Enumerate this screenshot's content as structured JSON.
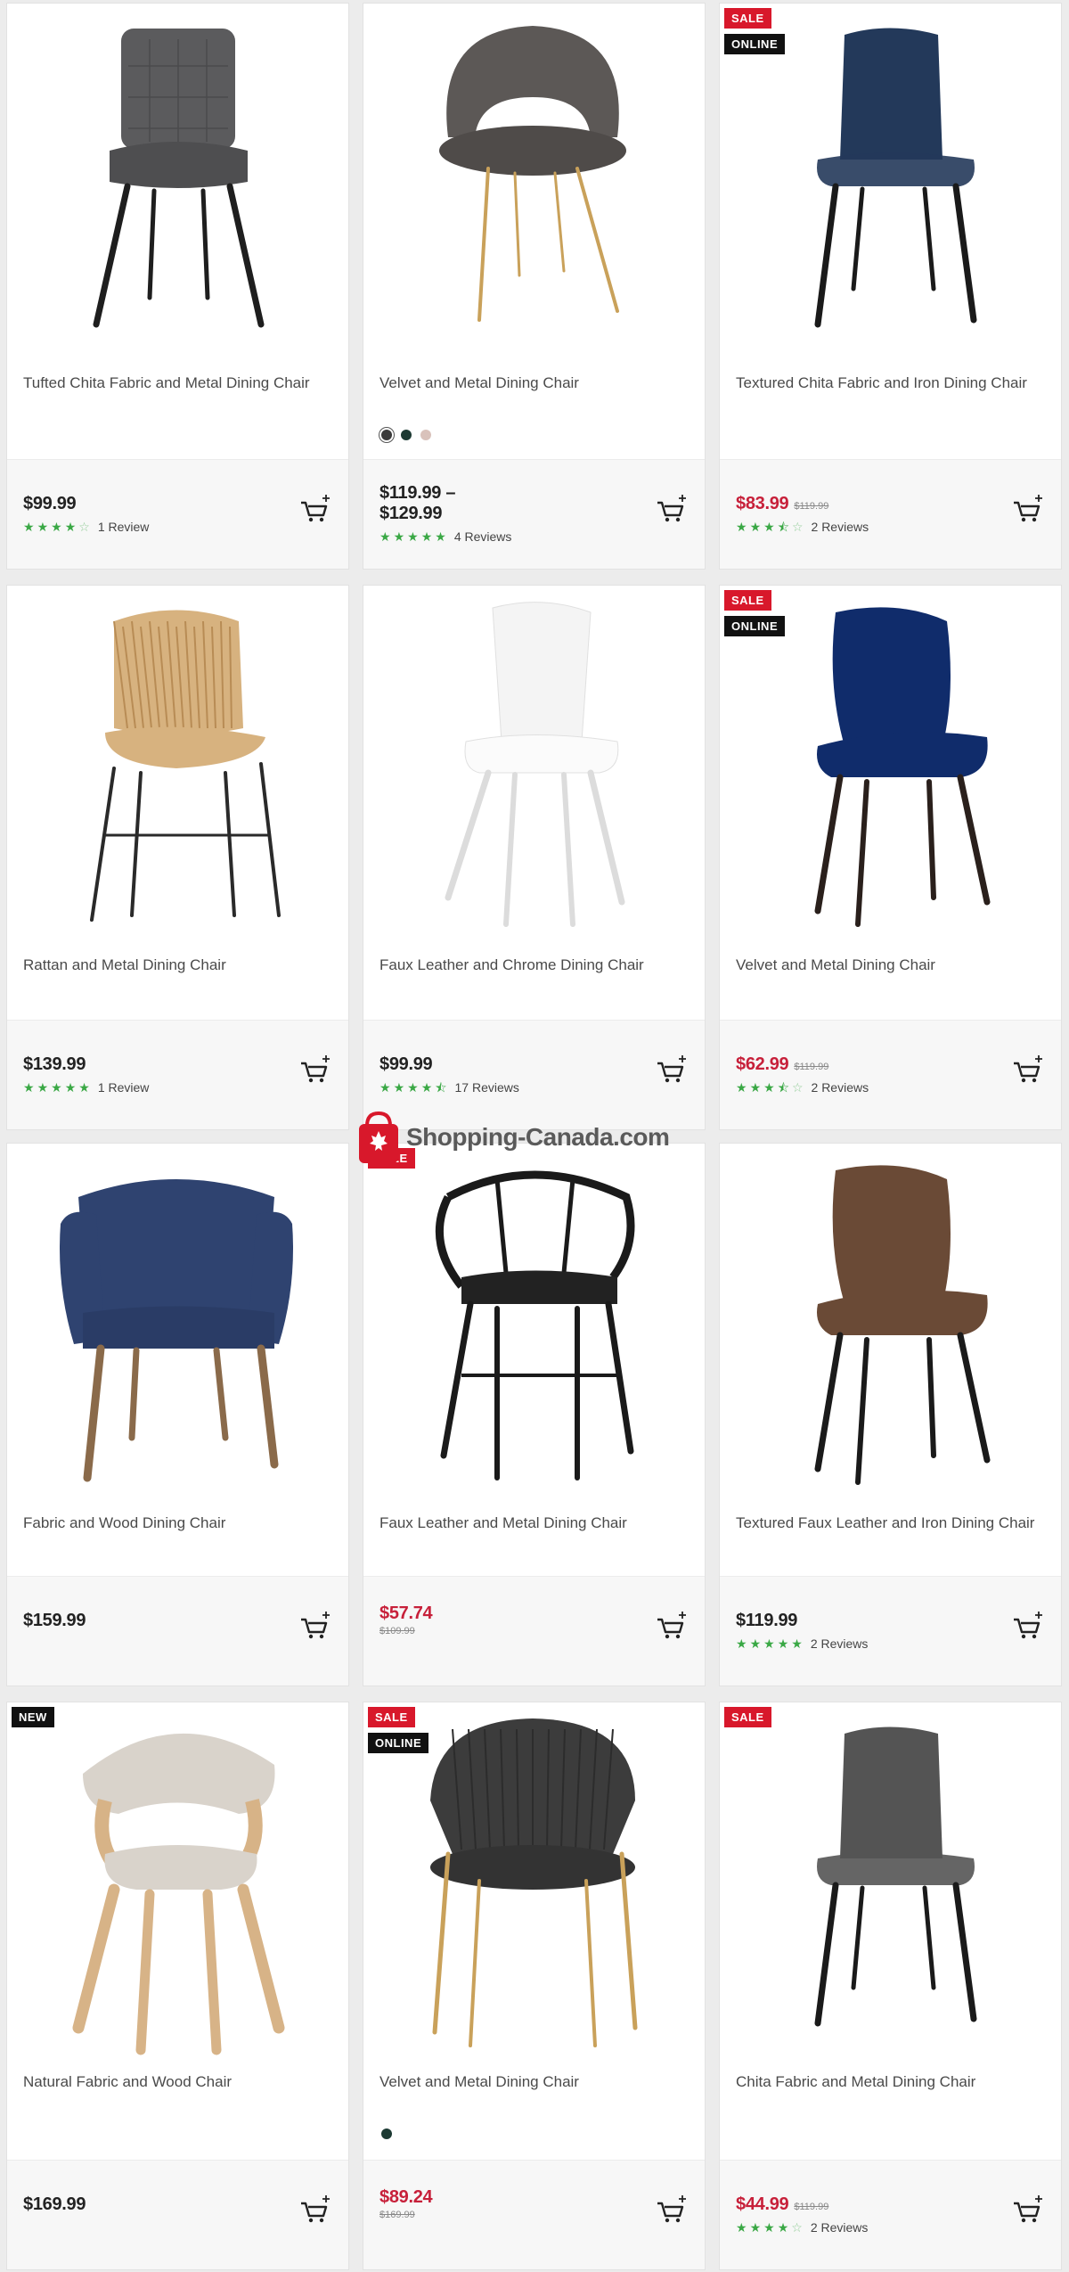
{
  "products": [
    {
      "name": "Tufted Chita Fabric and Metal Dining Chair",
      "price": "$99.99",
      "sale": false,
      "was": "",
      "stars": 4,
      "half": false,
      "reviews": "1 Review",
      "badges": [],
      "swatches": [],
      "chair": "tufted",
      "seat": "#5b5b5d",
      "legs": "#1e1e1e"
    },
    {
      "name": "Velvet and Metal Dining Chair",
      "price": "$119.99 –\n$129.99",
      "sale": false,
      "was": "",
      "stars": 5,
      "half": false,
      "reviews": "4 Reviews",
      "badges": [],
      "swatches": [
        "#3a3a3a",
        "#1d3a33",
        "#d9c2bb"
      ],
      "chair": "scoop",
      "seat": "#5c5856",
      "legs": "#c9a15a"
    },
    {
      "name": "Textured Chita Fabric and Iron Dining Chair",
      "price": "$83.99",
      "sale": true,
      "was": "$119.99",
      "stars": 3,
      "half": true,
      "reviews": "2 Reviews",
      "badges": [
        "SALE",
        "ONLINE"
      ],
      "swatches": [],
      "chair": "bucket",
      "seat": "#23395a",
      "legs": "#1a1a1a"
    },
    {
      "name": "Rattan and Metal Dining Chair",
      "price": "$139.99",
      "sale": false,
      "was": "",
      "stars": 5,
      "half": false,
      "reviews": "1 Review",
      "badges": [],
      "swatches": [],
      "chair": "rattan",
      "seat": "#d7b27f",
      "legs": "#2a2a2a"
    },
    {
      "name": "Faux Leather and Chrome Dining Chair",
      "price": "$99.99",
      "sale": false,
      "was": "",
      "stars": 4,
      "half": true,
      "reviews": "17 Reviews",
      "badges": [],
      "swatches": [],
      "chair": "shell",
      "seat": "#f4f4f4",
      "legs": "#dcdcdc"
    },
    {
      "name": "Velvet and Metal Dining Chair",
      "price": "$62.99",
      "sale": true,
      "was": "$119.99",
      "stars": 3,
      "half": true,
      "reviews": "2 Reviews",
      "badges": [
        "SALE",
        "ONLINE"
      ],
      "swatches": [],
      "chair": "wing",
      "seat": "#102c6b",
      "legs": "#2a201c"
    },
    {
      "name": "Fabric and Wood Dining Chair",
      "price": "$159.99",
      "sale": false,
      "was": "",
      "stars": 0,
      "half": false,
      "reviews": "",
      "badges": [],
      "swatches": [],
      "chair": "arm",
      "seat": "#2f4370",
      "legs": "#8a6a4a"
    },
    {
      "name": "Faux Leather and Metal Dining Chair",
      "price": "$57.74",
      "sale": true,
      "was": "$109.99",
      "stars": 0,
      "half": false,
      "reviews": "",
      "badges": [
        "SALE"
      ],
      "swatches": [],
      "chair": "metalarm",
      "seat": "#222",
      "legs": "#1a1a1a"
    },
    {
      "name": "Textured Faux Leather and Iron Dining Chair",
      "price": "$119.99",
      "sale": false,
      "was": "",
      "stars": 5,
      "half": false,
      "reviews": "2 Reviews",
      "badges": [],
      "swatches": [],
      "chair": "wing",
      "seat": "#6a4a36",
      "legs": "#1a1a1a"
    },
    {
      "name": "Natural Fabric and Wood Chair",
      "price": "$169.99",
      "sale": false,
      "was": "",
      "stars": 0,
      "half": false,
      "reviews": "",
      "badges": [
        "NEW"
      ],
      "swatches": [],
      "chair": "bentwood",
      "seat": "#d9d3cb",
      "legs": "#d7b387"
    },
    {
      "name": "Velvet and Metal Dining Chair",
      "price": "$89.24",
      "sale": true,
      "was": "$169.99",
      "stars": 0,
      "half": false,
      "reviews": "",
      "badges": [
        "SALE",
        "ONLINE"
      ],
      "swatches": [
        "#1d3a33"
      ],
      "chair": "barrel",
      "seat": "#3c3c3c",
      "legs": "#c9a15a"
    },
    {
      "name": "Chita Fabric and Metal Dining Chair",
      "price": "$44.99",
      "sale": true,
      "was": "$119.99",
      "stars": 4,
      "half": false,
      "reviews": "2 Reviews",
      "badges": [
        "SALE"
      ],
      "swatches": [],
      "chair": "bucket",
      "seat": "#545454",
      "legs": "#1a1a1a"
    }
  ],
  "watermark": "Shopping-Canada.com",
  "colors": {
    "sale": "#c7203a",
    "star": "#3aa845",
    "badge_sale": "#d8182b"
  }
}
